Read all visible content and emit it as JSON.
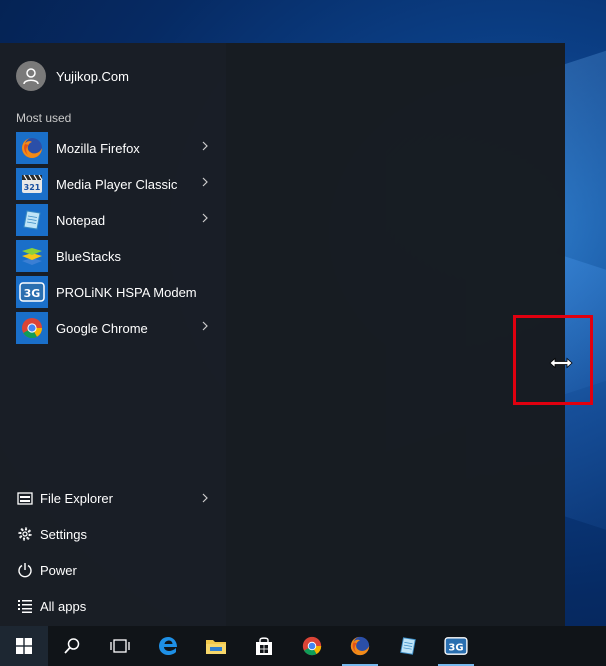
{
  "user": {
    "name": "Yujikop.Com"
  },
  "most_used": {
    "title": "Most used",
    "items": [
      {
        "label": "Mozilla Firefox",
        "icon": "firefox-icon",
        "has_submenu": true
      },
      {
        "label": "Media Player Classic",
        "icon": "media-player-classic-icon",
        "has_submenu": true
      },
      {
        "label": "Notepad",
        "icon": "notepad-icon",
        "has_submenu": true
      },
      {
        "label": "BlueStacks",
        "icon": "bluestacks-icon",
        "has_submenu": false
      },
      {
        "label": "PROLiNK HSPA Modem",
        "icon": "prolink-3g-icon",
        "has_submenu": false
      },
      {
        "label": "Google Chrome",
        "icon": "chrome-icon",
        "has_submenu": true
      }
    ]
  },
  "bottom": {
    "file_explorer": "File Explorer",
    "settings": "Settings",
    "power": "Power",
    "all_apps": "All apps"
  },
  "taskbar": {
    "items": [
      "start",
      "search",
      "task-view",
      "edge",
      "file-explorer",
      "store",
      "chrome",
      "firefox",
      "notepad",
      "prolink-3g"
    ],
    "prolink_label": "3G"
  },
  "colors": {
    "tile_blue": "#1a6fc9",
    "highlight": "#e0000f",
    "menu_bg": "#1a1e24",
    "taskbar_bg": "#101418"
  }
}
